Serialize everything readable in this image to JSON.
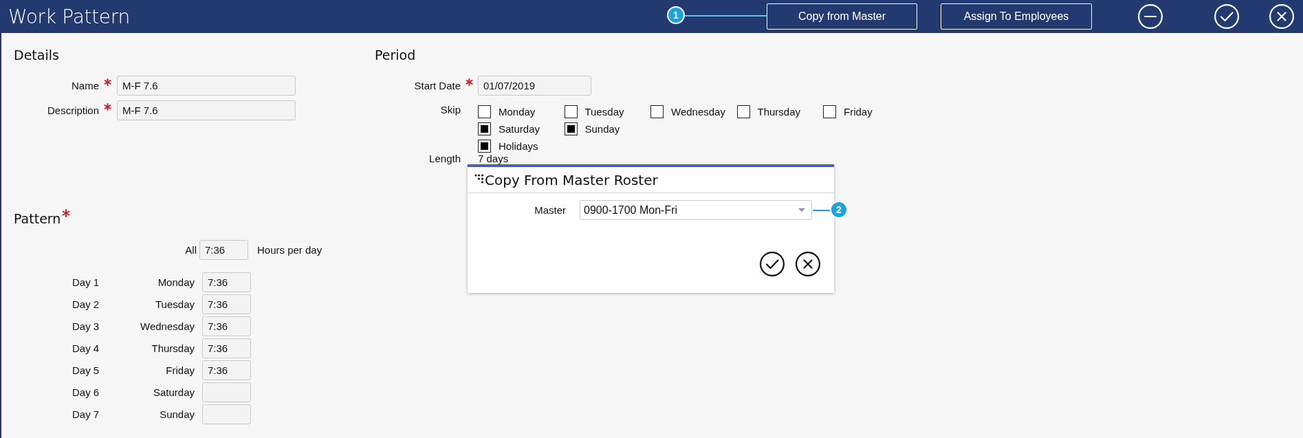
{
  "window": {
    "title": "Work Pattern"
  },
  "toolbar": {
    "buttons": [
      {
        "label": "Copy from Master",
        "callout": "1"
      },
      {
        "label": "Assign To Employees"
      }
    ],
    "icons": [
      {
        "kind": "minus"
      },
      {
        "kind": "check"
      },
      {
        "kind": "close"
      }
    ]
  },
  "details": {
    "title": "Details",
    "fields": [
      {
        "label": "Name",
        "required": true,
        "value": "M-F 7.6"
      },
      {
        "label": "Description",
        "required": true,
        "value": "M-F 7.6"
      }
    ]
  },
  "period": {
    "title": "Period",
    "start_date": {
      "label": "Start Date",
      "required": true,
      "value": "01/07/2019"
    },
    "skip": {
      "label": "Skip",
      "rows": [
        [
          {
            "label": "Monday",
            "checked": false
          },
          {
            "label": "Tuesday",
            "checked": false
          },
          {
            "label": "Wednesday",
            "checked": false
          },
          {
            "label": "Thursday",
            "checked": false
          },
          {
            "label": "Friday",
            "checked": false
          }
        ],
        [
          {
            "label": "Saturday",
            "checked": true
          },
          {
            "label": "Sunday",
            "checked": true
          }
        ],
        [
          {
            "label": "Holidays",
            "checked": true
          }
        ]
      ]
    },
    "length": {
      "label": "Length",
      "value": "7 days"
    }
  },
  "pattern": {
    "title": "Pattern",
    "required": true,
    "all": {
      "label": "All",
      "value": "7:36",
      "unit": "Hours per day"
    },
    "days": [
      {
        "day": "Day 1",
        "weekday": "Monday",
        "value": "7:36"
      },
      {
        "day": "Day 2",
        "weekday": "Tuesday",
        "value": "7:36"
      },
      {
        "day": "Day 3",
        "weekday": "Wednesday",
        "value": "7:36"
      },
      {
        "day": "Day 4",
        "weekday": "Thursday",
        "value": "7:36"
      },
      {
        "day": "Day 5",
        "weekday": "Friday",
        "value": "7:36"
      },
      {
        "day": "Day 6",
        "weekday": "Saturday"
      },
      {
        "day": "Day 7",
        "weekday": "Sunday"
      }
    ]
  },
  "dialog": {
    "title": "Copy From Master Roster",
    "field": {
      "label": "Master",
      "value": "0900-1700 Mon-Fri",
      "callout": "2"
    },
    "actions": [
      {
        "kind": "confirm"
      },
      {
        "kind": "cancel"
      }
    ]
  }
}
